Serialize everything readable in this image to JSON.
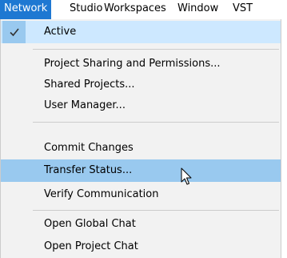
{
  "menubar": {
    "items": [
      {
        "label": "Network"
      },
      {
        "label": "Studio"
      },
      {
        "label": "Workspaces"
      },
      {
        "label": "Window"
      },
      {
        "label": "VST"
      }
    ]
  },
  "menu": {
    "active_label": "Active",
    "items": [
      {
        "label": "Project Sharing and Permissions..."
      },
      {
        "label": "Shared Projects..."
      },
      {
        "label": "User Manager..."
      },
      {
        "label": "Commit Changes"
      },
      {
        "label": "Transfer Status..."
      },
      {
        "label": "Verify Communication"
      },
      {
        "label": "Open Global Chat"
      },
      {
        "label": "Open Project Chat"
      }
    ]
  },
  "icons": {
    "check": "checkmark-icon",
    "cursor": "mouse-pointer-icon"
  },
  "colors": {
    "menubar_active": "#1e78d2",
    "checked_background": "#cde8ff",
    "hover_background": "#99c9ef",
    "menu_background": "#f2f2f2",
    "separator": "#cccccc"
  }
}
